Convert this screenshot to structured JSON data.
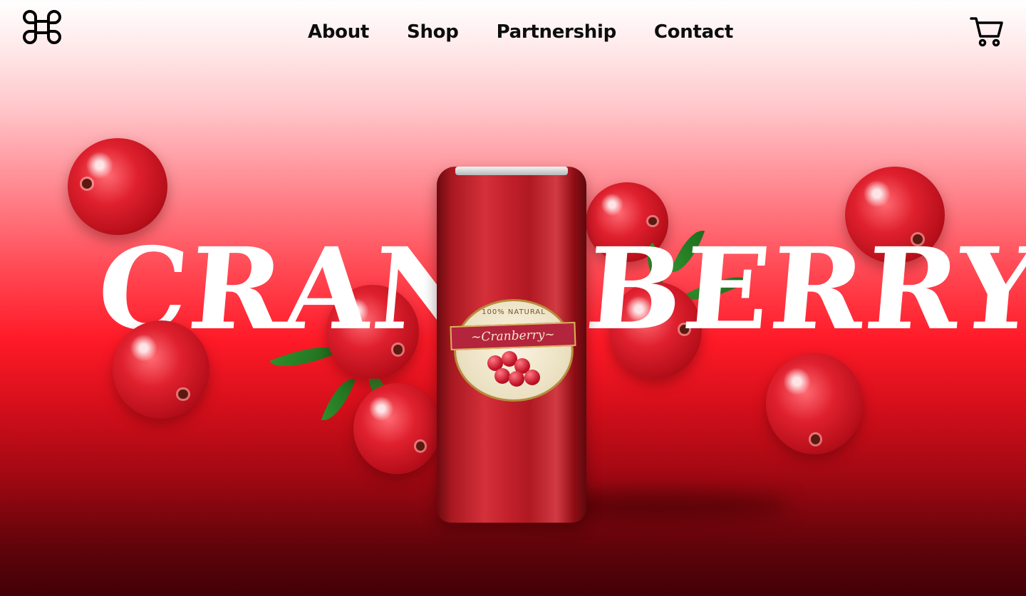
{
  "nav": {
    "logo_icon": "command-key-icon",
    "links": [
      {
        "label": "About"
      },
      {
        "label": "Shop"
      },
      {
        "label": "Partnership"
      },
      {
        "label": "Contact"
      }
    ],
    "cart_icon": "shopping-cart-icon"
  },
  "hero": {
    "word_left": "CRAN",
    "word_right": "BERRY",
    "product": {
      "label_top": "100% NATURAL",
      "label_name": "~Cranberry~"
    }
  },
  "colors": {
    "primary_red": "#ff1a27",
    "deep_red": "#5e040a",
    "text_dark": "#0d0d0d",
    "text_light": "#ffffff"
  }
}
